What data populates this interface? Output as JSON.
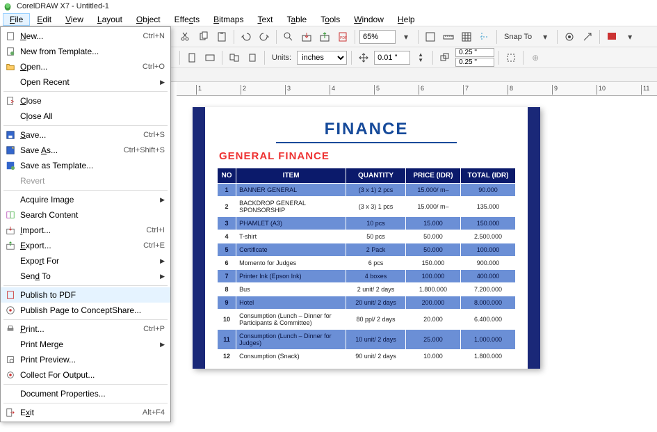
{
  "titlebar": {
    "text": "CorelDRAW X7 - Untitled-1"
  },
  "menubar": {
    "items": [
      {
        "label": "File",
        "u": "F"
      },
      {
        "label": "Edit",
        "u": "E"
      },
      {
        "label": "View",
        "u": "V"
      },
      {
        "label": "Layout",
        "u": "L"
      },
      {
        "label": "Object",
        "u": "O"
      },
      {
        "label": "Effects",
        "u": "c"
      },
      {
        "label": "Bitmaps",
        "u": "B"
      },
      {
        "label": "Text",
        "u": "T"
      },
      {
        "label": "Table",
        "u": "a"
      },
      {
        "label": "Tools",
        "u": "o"
      },
      {
        "label": "Window",
        "u": "W"
      },
      {
        "label": "Help",
        "u": "H"
      }
    ]
  },
  "toolbar1": {
    "zoom": "65%",
    "snap_to": "Snap To"
  },
  "toolbar2": {
    "units_label": "Units:",
    "units_value": "inches",
    "nudge_value": "0.01 \"",
    "dup_x": "0.25 \"",
    "dup_y": "0.25 \""
  },
  "ruler_ticks": [
    "1",
    "2",
    "3",
    "4",
    "5",
    "6",
    "7",
    "8",
    "9",
    "10",
    "11"
  ],
  "file_menu": {
    "items": [
      {
        "icon": "new",
        "label": "New...",
        "u": "N",
        "shortcut": "Ctrl+N"
      },
      {
        "icon": "template",
        "label": "New from Template...",
        "u": "F"
      },
      {
        "icon": "open",
        "label": "Open...",
        "u": "O",
        "shortcut": "Ctrl+O"
      },
      {
        "icon": "",
        "label": "Open Recent",
        "u": "",
        "submenu": true
      },
      {
        "sep": true
      },
      {
        "icon": "close",
        "label": "Close",
        "u": "C"
      },
      {
        "icon": "",
        "label": "Close All",
        "u": "l"
      },
      {
        "sep": true
      },
      {
        "icon": "save",
        "label": "Save...",
        "u": "S",
        "shortcut": "Ctrl+S"
      },
      {
        "icon": "saveas",
        "label": "Save As...",
        "u": "A",
        "shortcut": "Ctrl+Shift+S"
      },
      {
        "icon": "savetpl",
        "label": "Save as Template..."
      },
      {
        "icon": "",
        "label": "Revert",
        "u": "",
        "disabled": true
      },
      {
        "sep": true
      },
      {
        "icon": "",
        "label": "Acquire Image",
        "submenu": true
      },
      {
        "icon": "search",
        "label": "Search Content"
      },
      {
        "icon": "import",
        "label": "Import...",
        "u": "I",
        "shortcut": "Ctrl+I"
      },
      {
        "icon": "export",
        "label": "Export...",
        "u": "E",
        "shortcut": "Ctrl+E"
      },
      {
        "icon": "",
        "label": "Export For",
        "u": "r",
        "submenu": true
      },
      {
        "icon": "",
        "label": "Send To",
        "u": "d",
        "submenu": true
      },
      {
        "sep": true
      },
      {
        "icon": "pdf",
        "label": "Publish to PDF",
        "u": "H",
        "highlighted": true
      },
      {
        "icon": "concept",
        "label": "Publish Page to ConceptShare..."
      },
      {
        "sep": true
      },
      {
        "icon": "print",
        "label": "Print...",
        "u": "P",
        "shortcut": "Ctrl+P"
      },
      {
        "icon": "",
        "label": "Print Merge",
        "u": "g",
        "submenu": true
      },
      {
        "icon": "preview",
        "label": "Print Preview...",
        "u": "R"
      },
      {
        "icon": "collect",
        "label": "Collect For Output..."
      },
      {
        "sep": true
      },
      {
        "icon": "",
        "label": "Document Properties..."
      },
      {
        "sep": true
      },
      {
        "icon": "exit",
        "label": "Exit",
        "u": "x",
        "shortcut": "Alt+F4"
      }
    ]
  },
  "document": {
    "title": "FINANCE",
    "subtitle": "GENERAL FINANCE",
    "headers": {
      "no": "NO",
      "item": "ITEM",
      "qty": "QUANTITY",
      "price": "PRICE (IDR)",
      "total": "TOTAL (IDR)"
    },
    "rows": [
      {
        "no": "1",
        "item": "BANNER GENERAL",
        "qty": "(3 x 1) 2 pcs",
        "price": "15.000/ m–",
        "total": "90.000"
      },
      {
        "no": "2",
        "item": "BACKDROP GENERAL SPONSORSHIP",
        "qty": "(3 x 3) 1 pcs",
        "price": "15.000/ m–",
        "total": "135.000"
      },
      {
        "no": "3",
        "item": "PHAMLET (A3)",
        "qty": "10 pcs",
        "price": "15.000",
        "total": "150.000"
      },
      {
        "no": "4",
        "item": "T-shirt",
        "qty": "50 pcs",
        "price": "50.000",
        "total": "2.500.000"
      },
      {
        "no": "5",
        "item": "Certificate",
        "qty": "2 Pack",
        "price": "50.000",
        "total": "100.000"
      },
      {
        "no": "6",
        "item": "Momento for Judges",
        "qty": "6 pcs",
        "price": "150.000",
        "total": "900.000"
      },
      {
        "no": "7",
        "item": "Printer Ink (Epson Ink)",
        "qty": "4 boxes",
        "price": "100.000",
        "total": "400.000"
      },
      {
        "no": "8",
        "item": "Bus",
        "qty": "2 unit/ 2 days",
        "price": "1.800.000",
        "total": "7.200.000"
      },
      {
        "no": "9",
        "item": "Hotel",
        "qty": "20 unit/ 2 days",
        "price": "200.000",
        "total": "8.000.000"
      },
      {
        "no": "10",
        "item": "Consumption (Lunch – Dinner for Participants & Committee)",
        "qty": "80 ppl/ 2 days",
        "price": "20.000",
        "total": "6.400.000"
      },
      {
        "no": "11",
        "item": "Consumption (Lunch – Dinner for Judges)",
        "qty": "10 unit/ 2 days",
        "price": "25.000",
        "total": "1.000.000"
      },
      {
        "no": "12",
        "item": "Consumption (Snack)",
        "qty": "90 unit/ 2 days",
        "price": "10.000",
        "total": "1.800.000"
      }
    ]
  }
}
